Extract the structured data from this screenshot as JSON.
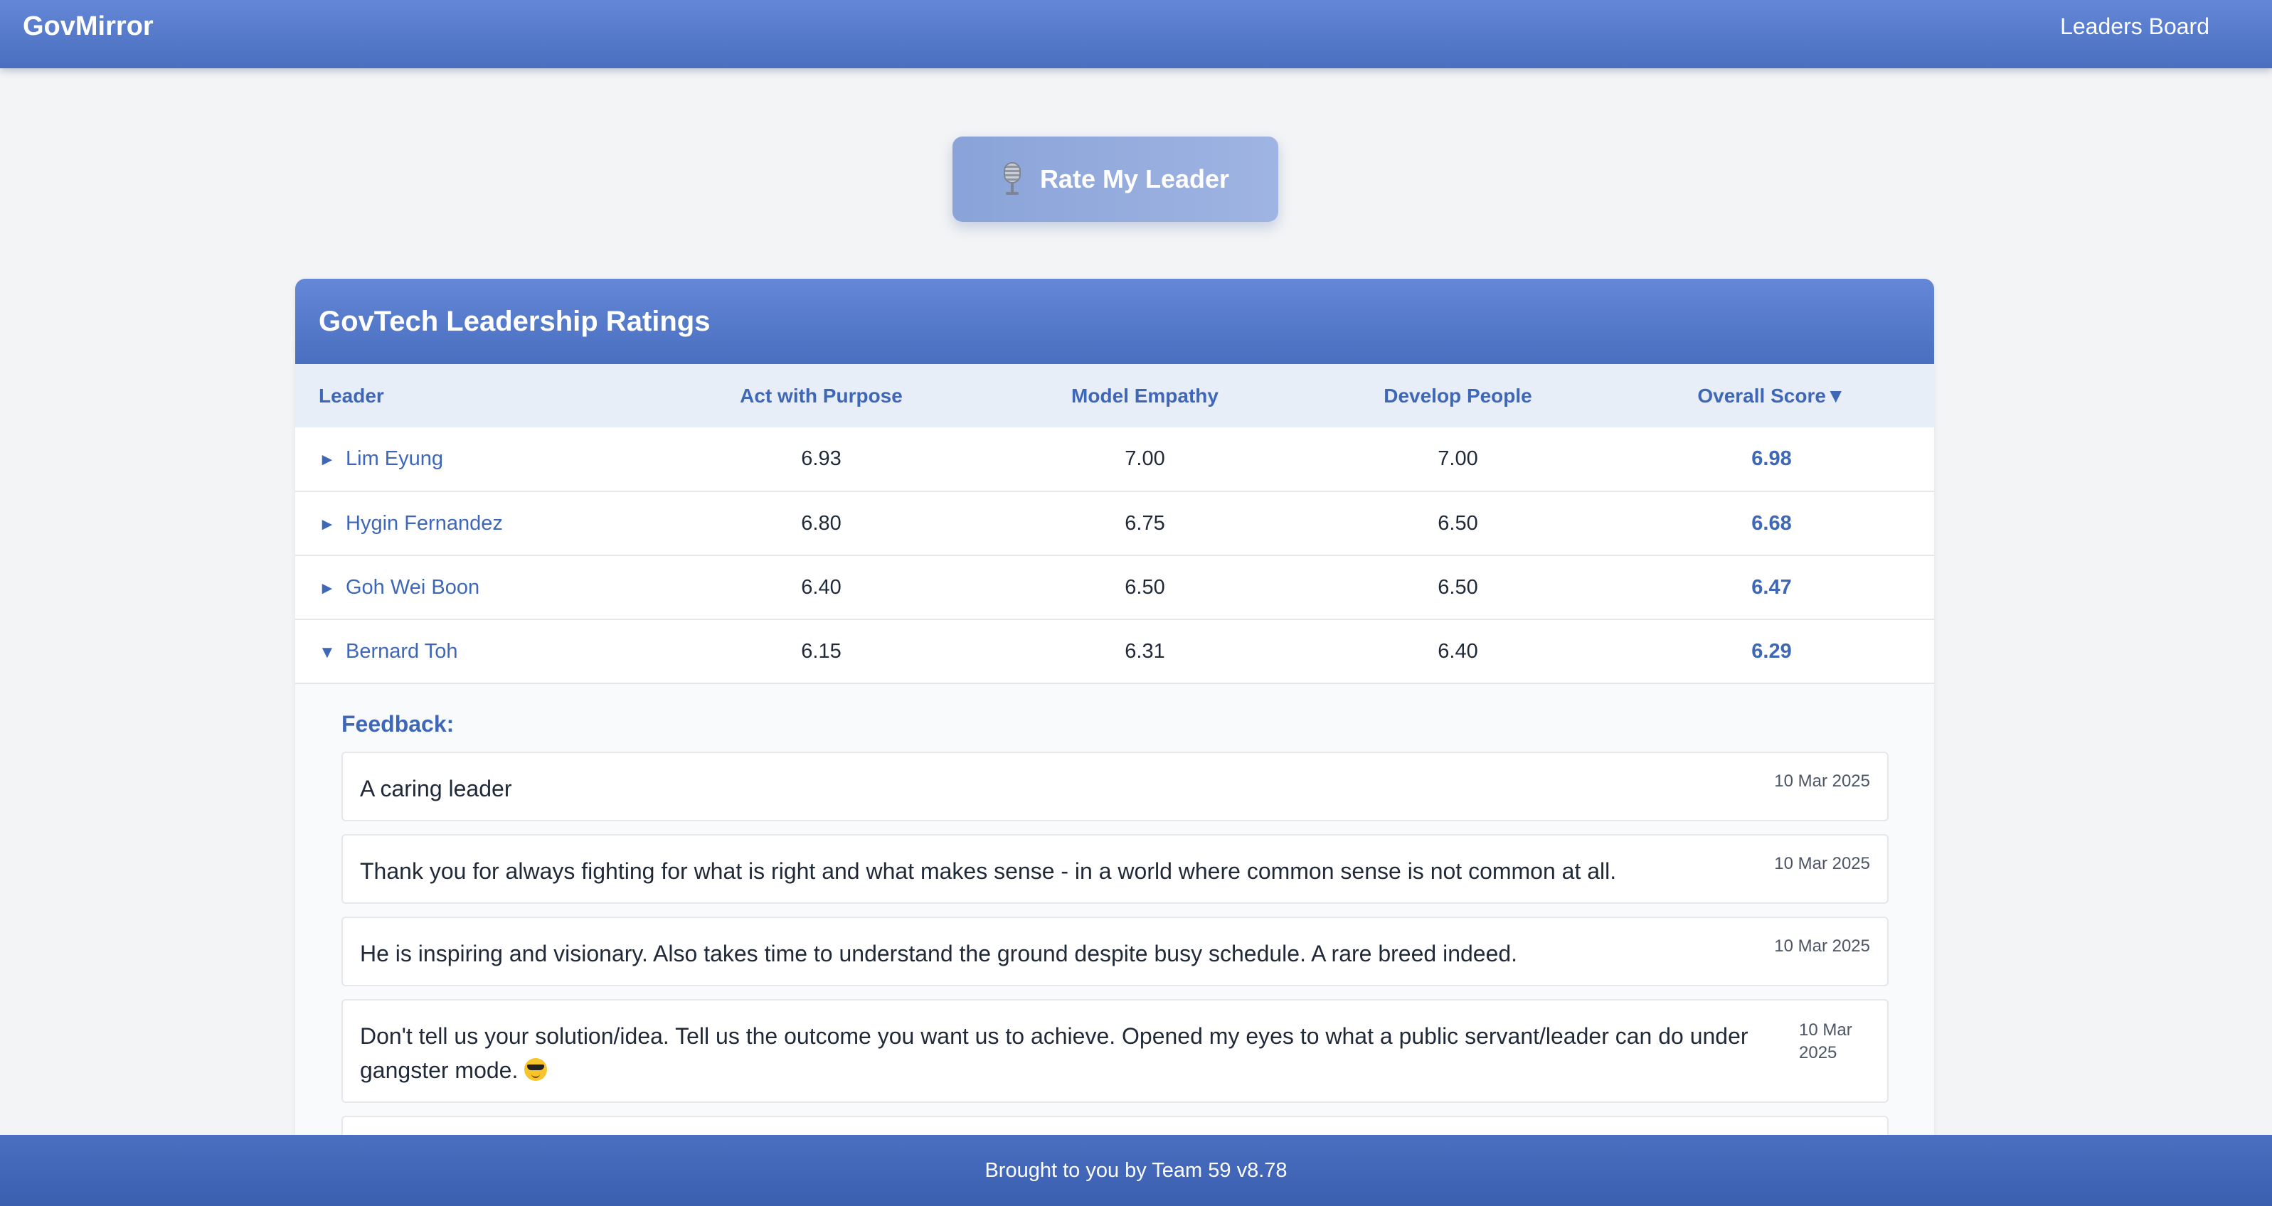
{
  "app": {
    "brand": "GovMirror",
    "nav_link": "Leaders Board"
  },
  "rate_button": {
    "label": "Rate My Leader",
    "icon": "microphone-icon"
  },
  "ratings": {
    "title": "GovTech Leadership Ratings",
    "columns": [
      "Leader",
      "Act with Purpose",
      "Model Empathy",
      "Develop People",
      "Overall Score▼"
    ],
    "rows": [
      {
        "toggle": "►",
        "name": "Lim Eyung",
        "act": "6.93",
        "empathy": "7.00",
        "develop": "7.00",
        "overall": "6.98"
      },
      {
        "toggle": "►",
        "name": "Hygin Fernandez",
        "act": "6.80",
        "empathy": "6.75",
        "develop": "6.50",
        "overall": "6.68"
      },
      {
        "toggle": "►",
        "name": "Goh Wei Boon",
        "act": "6.40",
        "empathy": "6.50",
        "develop": "6.50",
        "overall": "6.47"
      },
      {
        "toggle": "▼",
        "name": "Bernard Toh",
        "act": "6.15",
        "empathy": "6.31",
        "develop": "6.40",
        "overall": "6.29"
      }
    ]
  },
  "feedback": {
    "title": "Feedback:",
    "items": [
      {
        "text": "A caring leader",
        "date": "10 Mar 2025"
      },
      {
        "text": "Thank you for always fighting for what is right and what makes sense - in a world where common sense is not common at all.",
        "date": "10 Mar 2025"
      },
      {
        "text": "He is inspiring and visionary. Also takes time to understand the ground despite busy schedule. A rare breed indeed.",
        "date": "10 Mar 2025"
      },
      {
        "text": "Don't tell us your solution/idea. Tell us the outcome you want us to achieve. Opened my eyes to what a public servant/leader can do under gangster mode.",
        "date": "10 Mar 2025",
        "emoji": "smiling-face-with-sunglasses-icon"
      }
    ]
  },
  "footer": {
    "text": "Brought to you by Team 59 v8.78"
  },
  "colors": {
    "primary": "#4a6fc0",
    "accent_text": "#3f67b8",
    "background": "#f3f4f6"
  }
}
